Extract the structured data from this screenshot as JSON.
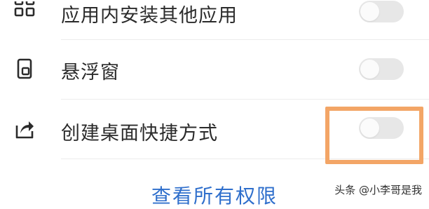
{
  "settings": {
    "items": [
      {
        "label": "应用内安装其他应用",
        "icon": "grid-apps-icon",
        "enabled": false
      },
      {
        "label": "悬浮窗",
        "icon": "floating-window-icon",
        "enabled": false
      },
      {
        "label": "创建桌面快捷方式",
        "icon": "share-export-icon",
        "enabled": false
      }
    ],
    "view_all_label": "查看所有权限"
  },
  "watermark": "头条 @小李哥是我",
  "colors": {
    "accent_link": "#2f6fcc",
    "highlight_border": "#f3a566",
    "toggle_off": "#e7e7e7",
    "text": "#2b2b2b"
  }
}
